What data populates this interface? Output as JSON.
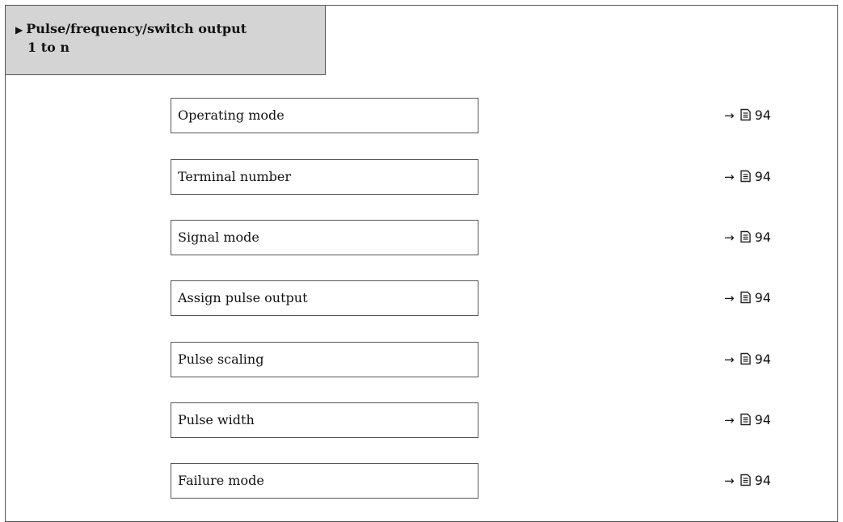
{
  "header": {
    "marker_glyph": "▶",
    "title_line1": "Pulse/frequency/switch output",
    "title_line2": "1 to n"
  },
  "reference_arrow": "→",
  "reference_icon": "book-icon",
  "parameters": [
    {
      "label": "Operating mode",
      "page": "94"
    },
    {
      "label": "Terminal number",
      "page": "94"
    },
    {
      "label": "Signal mode",
      "page": "94"
    },
    {
      "label": "Assign pulse output",
      "page": "94"
    },
    {
      "label": "Pulse scaling",
      "page": "94"
    },
    {
      "label": "Pulse width",
      "page": "94"
    },
    {
      "label": "Failure mode",
      "page": "94"
    }
  ]
}
